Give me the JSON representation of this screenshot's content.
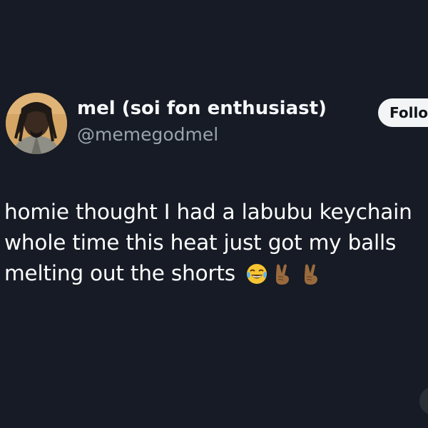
{
  "post": {
    "author": {
      "display_name": "mel (soi fon enthusiast)",
      "handle": "@memegodmel",
      "avatar_icon": "profile-photo"
    },
    "follow_button": {
      "label": "Follo"
    },
    "text_lines": [
      "homie thought I had a labubu keychain",
      "whole time this heat just got my balls",
      "melting out the shorts"
    ],
    "emojis": [
      "face-with-tears-of-joy-emoji",
      "victory-hand-emoji",
      "victory-hand-emoji"
    ]
  },
  "colors": {
    "background": "#161b25",
    "text": "#ffffff",
    "handle": "#9aa3ad",
    "follow_button_bg": "#f3f4f6",
    "follow_button_text": "#0f1419"
  }
}
